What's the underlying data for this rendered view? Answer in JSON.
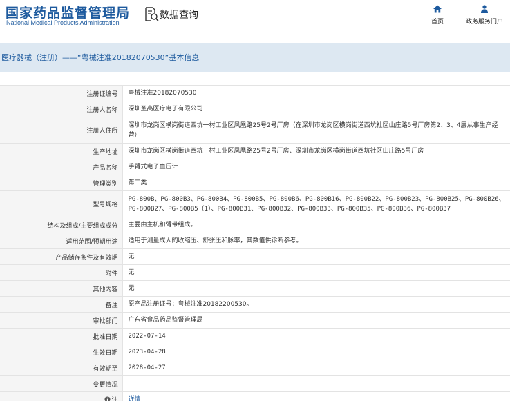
{
  "header": {
    "logo_cn": "国家药品监督管理局",
    "logo_en": "National Medical Products Administration",
    "query_label": "数据查询",
    "nav": [
      {
        "label": "首页",
        "icon": "home-icon"
      },
      {
        "label": "政务服务门户",
        "icon": "person-group-icon"
      }
    ]
  },
  "title": "医疗器械（注册）——“粤械注准20182070530”基本信息",
  "fields": [
    {
      "label": "注册证编号",
      "value": "粤械注准20182070530"
    },
    {
      "label": "注册人名称",
      "value": "深圳圣高医疗电子有限公司"
    },
    {
      "label": "注册人住所",
      "value": "深圳市龙岗区横岗街道西坑一村工业区凤凰路25号2号厂房（在深圳市龙岗区横岗街道西坑社区山庄路5号厂房第2、3、4层从事生产经营）"
    },
    {
      "label": "生产地址",
      "value": "深圳市龙岗区横岗街道西坑一村工业区凤凰路25号2号厂房、深圳市龙岗区横岗街道西坑社区山庄路5号厂房"
    },
    {
      "label": "产品名称",
      "value": "手臂式电子血压计"
    },
    {
      "label": "管理类别",
      "value": "第二类"
    },
    {
      "label": "型号规格",
      "value": "PG-800B、PG-800B3、PG-800B4、PG-800B5、PG-800B6、PG-800B16、PG-800B22、PG-800B23、PG-800B25、PG-800B26、PG-800B27、PG-800B5（1）、PG-800B31、PG-800B32、PG-800B33、PG-800B35、PG-800B36、PG-800B37"
    },
    {
      "label": "结构及组成/主要组成成分",
      "value": "主要由主机和臂带组成。"
    },
    {
      "label": "适用范围/预期用途",
      "value": "适用于测量成人的收缩压、舒张压和脉率，其数值供诊断参考。"
    },
    {
      "label": "产品储存条件及有效期",
      "value": "无"
    },
    {
      "label": "附件",
      "value": "无"
    },
    {
      "label": "其他内容",
      "value": "无"
    },
    {
      "label": "备注",
      "value": "原产品注册证号：粤械注准20182200530。"
    },
    {
      "label": "审批部门",
      "value": "广东省食品药品监督管理局"
    },
    {
      "label": "批准日期",
      "value": "2022-07-14"
    },
    {
      "label": "生效日期",
      "value": "2023-04-28"
    },
    {
      "label": "有效期至",
      "value": "2028-04-27"
    },
    {
      "label": "变更情况",
      "value": ""
    },
    {
      "label": "注",
      "value": "详情",
      "icon": "info-icon"
    }
  ],
  "colors": {
    "brand": "#1d5a9e",
    "title_bar_bg": "#dde8f2",
    "label_bg": "#f5f5f5",
    "border": "#e3e3e3"
  }
}
